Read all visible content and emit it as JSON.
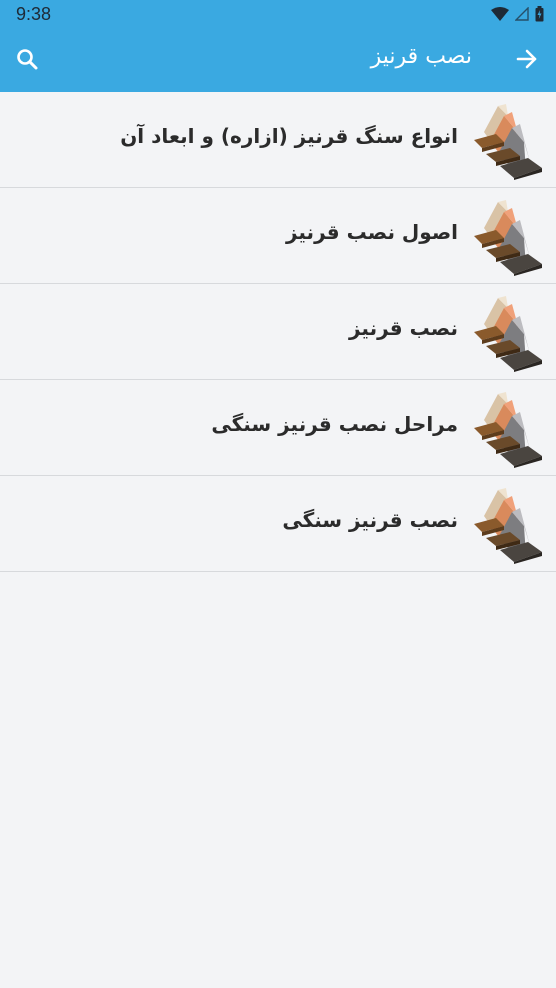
{
  "status_bar": {
    "time": "9:38",
    "icons": [
      "wifi-icon",
      "signal-icon",
      "battery-icon"
    ]
  },
  "app_bar": {
    "title": "نصب قرنیز",
    "back_icon": "arrow-forward-icon",
    "search_icon": "search-icon",
    "color": "#3aa9e1"
  },
  "list": {
    "items": [
      {
        "label": "انواع سنگ قرنیز (ازاره) و ابعاد آن",
        "icon": "moulding-thumbnail"
      },
      {
        "label": "اصول نصب قرنیز",
        "icon": "moulding-thumbnail"
      },
      {
        "label": "نصب قرنیز",
        "icon": "moulding-thumbnail"
      },
      {
        "label": "مراحل نصب قرنیز سنگی",
        "icon": "moulding-thumbnail"
      },
      {
        "label": "نصب قرنیز سنگی",
        "icon": "moulding-thumbnail"
      }
    ]
  }
}
